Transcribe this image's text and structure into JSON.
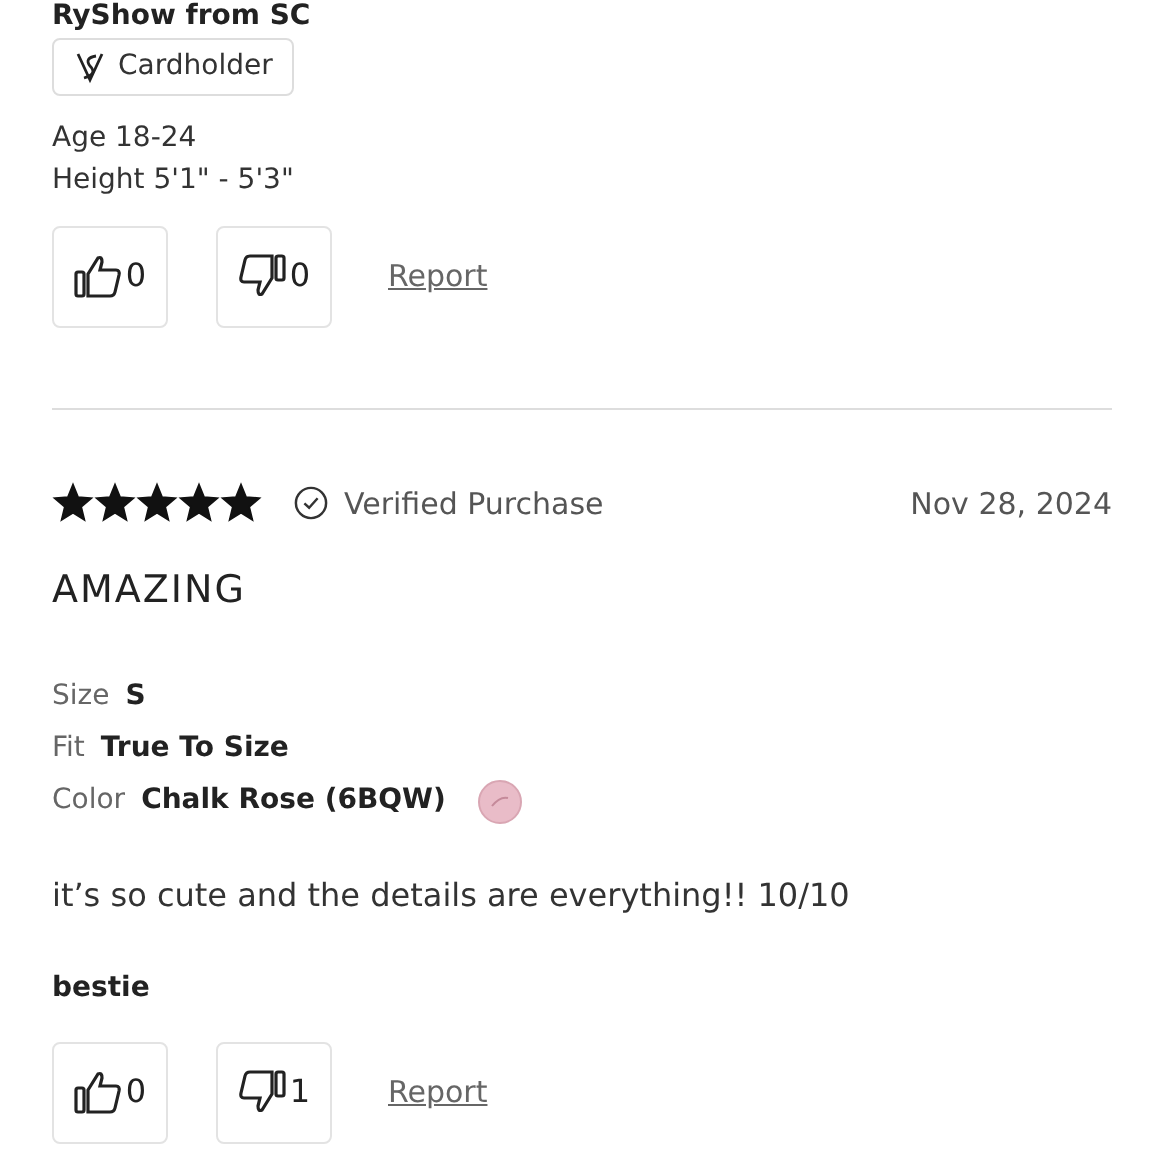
{
  "reviews": [
    {
      "reviewer": "RyShow from SC",
      "badge": "Cardholder",
      "details": [
        {
          "label": "Age",
          "value": "18-24"
        },
        {
          "label": "Height",
          "value": "5'1\" - 5'3\""
        }
      ],
      "helpful": "0",
      "unhelpful": "0",
      "report": "Report"
    },
    {
      "stars": 5,
      "verified": "Verified Purchase",
      "date": "Nov 28, 2024",
      "title": "AMAZING",
      "attributes": [
        {
          "label": "Size",
          "value": "S",
          "kind": "text"
        },
        {
          "label": "Fit",
          "value": "True To Size",
          "kind": "text"
        },
        {
          "label": "Color",
          "value": "Chalk Rose (6BQW)",
          "kind": "swatch"
        }
      ],
      "body": "it’s so cute and the details are everything!! 10/10",
      "reviewer": "bestie",
      "helpful": "0",
      "unhelpful": "1",
      "report": "Report"
    }
  ]
}
